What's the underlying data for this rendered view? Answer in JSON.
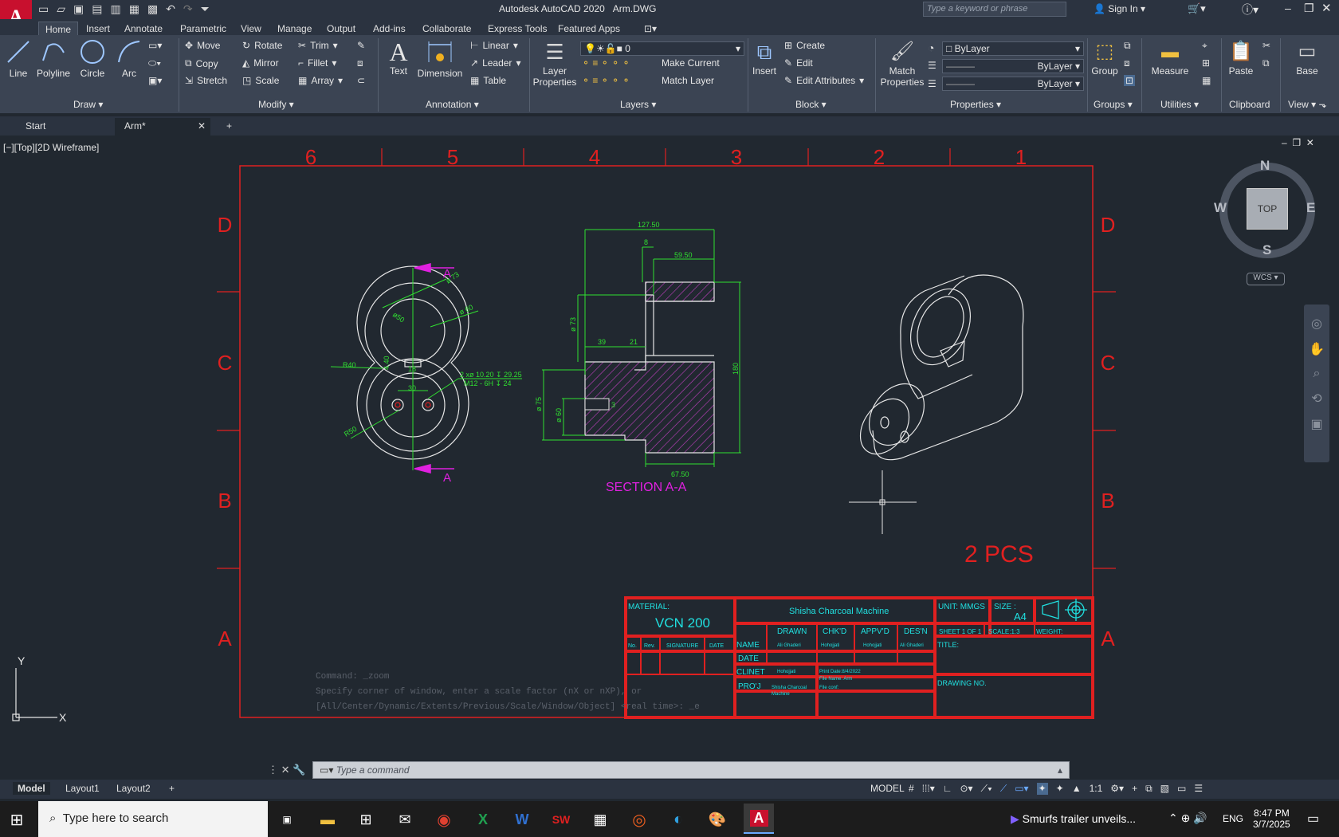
{
  "app": {
    "title": "Autodesk AutoCAD 2020",
    "file": "Arm.DWG",
    "search_placeholder": "Type a keyword or phrase",
    "sign_in": "Sign In"
  },
  "ribbon_tabs": [
    "Home",
    "Insert",
    "Annotate",
    "Parametric",
    "View",
    "Manage",
    "Output",
    "Add-ins",
    "Collaborate",
    "Express Tools",
    "Featured Apps"
  ],
  "draw": {
    "line": "Line",
    "polyline": "Polyline",
    "circle": "Circle",
    "arc": "Arc",
    "label": "Draw"
  },
  "modify": {
    "move": "Move",
    "rotate": "Rotate",
    "trim": "Trim",
    "copy": "Copy",
    "mirror": "Mirror",
    "fillet": "Fillet",
    "stretch": "Stretch",
    "scale": "Scale",
    "array": "Array",
    "label": "Modify"
  },
  "annotation": {
    "text": "Text",
    "dimension": "Dimension",
    "linear": "Linear",
    "leader": "Leader",
    "table": "Table",
    "label": "Annotation"
  },
  "layers": {
    "layer_properties_1": "Layer",
    "layer_properties_2": "Properties",
    "current_layer": "0",
    "make_current": "Make Current",
    "match_layer": "Match Layer",
    "label": "Layers"
  },
  "block": {
    "insert": "Insert",
    "create": "Create",
    "edit": "Edit",
    "edit_attributes": "Edit Attributes",
    "label": "Block"
  },
  "properties": {
    "match_1": "Match",
    "match_2": "Properties",
    "color": "ByLayer",
    "linetype": "ByLayer",
    "lineweight": "ByLayer",
    "label": "Properties"
  },
  "groups": {
    "group": "Group",
    "label": "Groups"
  },
  "utilities": {
    "measure": "Measure",
    "label": "Utilities"
  },
  "clipboard": {
    "paste": "Paste",
    "label": "Clipboard"
  },
  "view_panel": {
    "base": "Base",
    "label": "View"
  },
  "doc_tabs": {
    "start": "Start",
    "arm": "Arm*"
  },
  "viewport_label": "[−][Top][2D Wireframe]",
  "viewcube": {
    "n": "N",
    "s": "S",
    "e": "E",
    "w": "W",
    "top": "TOP",
    "wcs": "WCS"
  },
  "frame": {
    "cols_top": [
      "6",
      "5",
      "4",
      "3",
      "2",
      "1"
    ],
    "rows": [
      "D",
      "C",
      "B",
      "A"
    ]
  },
  "drawing": {
    "section_title": "SECTION A-A",
    "section_mark": "A",
    "pcs": "2 PCS",
    "dims_front": {
      "r40": "R40",
      "d73": "ø 73",
      "d60": "ø 60",
      "d50": "ø50",
      "r50": "R50",
      "d18": "18",
      "d30": "30",
      "d440": "4.40",
      "hole1": "2 xø 10.20 ↧ 29.25",
      "hole2": "M12 - 6H ↧ 24"
    },
    "dims_section": {
      "w127": "127.50",
      "w8": "8",
      "w59": "59.50",
      "d73": "ø 73",
      "w39": "39",
      "w21": "21",
      "h180": "180",
      "d75": "ø 75",
      "d60": "ø 60",
      "w67": "67.50",
      "m3": "3"
    }
  },
  "title_block": {
    "material_label": "MATERIAL:",
    "material": "VCN 200",
    "project": "Shisha Charcoal Machine",
    "unit": "UNIT: MMGS",
    "size_label": "SIZE :",
    "size": "A4",
    "drawn": "DRAWN",
    "chkd": "CHK'D",
    "appvd": "APPV'D",
    "desn": "DES'N",
    "sheet": "SHEET 1 OF 1",
    "scale": "SCALE:1:3",
    "weight": "WEIGHT:",
    "no": "No.",
    "rev": "Rev.",
    "signature": "SIGNATURE",
    "date_col": "DATE",
    "name": "NAME",
    "date": "DATE",
    "client": "CLINET",
    "proj": "PRO'J",
    "title": "TITLE:",
    "drawing_no": "DRAWING NO.",
    "name_drawn": "Ali Ghaderi",
    "name_chkd": "Hohojjati",
    "name_appvd": "Hohojjati",
    "name_desn": "Ali Ghaderi",
    "client_name": "Hohojjati",
    "print_date": "Print Date:8/4/2022",
    "file_name": "File Name:  Arm",
    "file_conf": "File conf:",
    "proj_name_1": "Shisha Charcoal",
    "proj_name_2": "Machine"
  },
  "command": {
    "history1": "Command: _zoom",
    "history2": "Specify corner of window, enter a scale factor (nX or nXP), or",
    "history3": "[All/Center/Dynamic/Extents/Previous/Scale/Window/Object] <real time>: _e",
    "placeholder": "Type a command"
  },
  "layout_tabs": [
    "Model",
    "Layout1",
    "Layout2"
  ],
  "status": {
    "model": "MODEL",
    "scale": "1:1"
  },
  "ucs": {
    "x": "X",
    "y": "Y"
  },
  "taskbar": {
    "search": "Type here to search",
    "news": "Smurfs trailer unveils...",
    "lang": "ENG",
    "time": "8:47 PM",
    "date": "3/7/2025"
  }
}
